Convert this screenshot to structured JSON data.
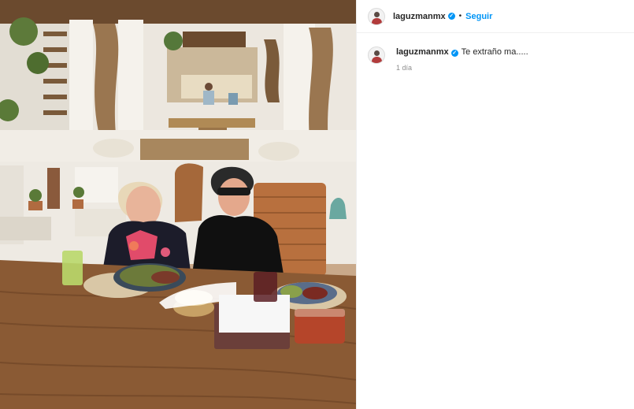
{
  "post": {
    "username": "laguzmanmx",
    "follow_label": "Seguir",
    "dot": "•",
    "verified_mark": "✓"
  },
  "caption": {
    "username": "laguzmanmx",
    "text": "Te extraño ma.....",
    "time": "1 día"
  },
  "colors": {
    "accent": "#0095f6",
    "secondary_text": "#8e8e8e"
  }
}
